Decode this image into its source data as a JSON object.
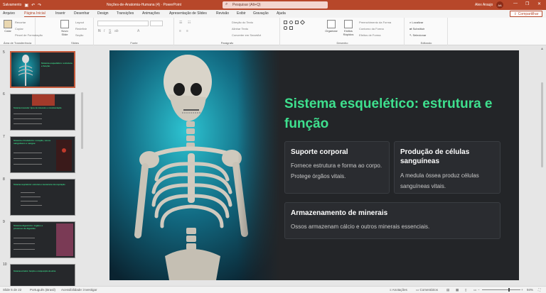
{
  "titlebar": {
    "autosave": "Salvamento",
    "doc_title": "Noções-de-Anatomia-Humana (4)  ·  PowerPoint",
    "search_placeholder": "Pesquisar (Alt+Q)",
    "user": "Alex Araujo",
    "avatar": "AA",
    "minimize": "—",
    "restore": "❐",
    "close": "✕"
  },
  "tabs": [
    "Arquivo",
    "Página Inicial",
    "Inserir",
    "Desenhar",
    "Design",
    "Transições",
    "Animações",
    "Apresentação de Slides",
    "Revisão",
    "Exibir",
    "Gravação",
    "Ajuda"
  ],
  "active_tab": "Página Inicial",
  "share_label": "Compartilhar",
  "ribbon": {
    "clipboard": {
      "label": "Área de Transferência",
      "paste": "Colar",
      "cut": "Recortar",
      "copy": "Copiar",
      "format_painter": "Pincel de Formatação"
    },
    "slides": {
      "label": "Slides",
      "new_slide": "Novo Slide",
      "layout": "Layout",
      "reset": "Redefinir",
      "section": "Seção"
    },
    "font": {
      "label": "Fonte"
    },
    "paragraph": {
      "label": "Parágrafo",
      "text_direction": "Direção do Texto",
      "align_text": "Alinhar Texto",
      "smartart": "Converter em SmartArt"
    },
    "drawing": {
      "label": "Desenho",
      "arrange": "Organizar",
      "quick_styles": "Estilos Rápidos",
      "fill": "Preenchimento da Forma",
      "outline": "Contorno da Forma",
      "effects": "Efeitos de Forma"
    },
    "editing": {
      "label": "Editando",
      "find": "Localizar",
      "replace": "Substituir",
      "select": "Selecionar"
    }
  },
  "thumbnails": [
    {
      "num": "5",
      "title": "Sistema esquelético: estrutura e função"
    },
    {
      "num": "6",
      "title": "Sistema muscular: tipos de músculos e movimentação"
    },
    {
      "num": "7",
      "title": "Sistema circulatório: coração, vasos sanguíneos e sangue"
    },
    {
      "num": "8",
      "title": "Sistema respiratório: estrutura e mecanismo da respiração"
    },
    {
      "num": "9",
      "title": "Sistema digestório: órgãos e processo de digestão"
    },
    {
      "num": "10",
      "title": "Sistema urinário: função e composição da urina"
    }
  ],
  "slide": {
    "title": "Sistema esquelético: estrutura e função",
    "cards": [
      {
        "heading": "Suporte corporal",
        "body": "Fornece estrutura e forma ao corpo. Protege órgãos vitais."
      },
      {
        "heading": "Produção de células sanguíneas",
        "body": "A medula óssea produz células sanguíneas vitais."
      },
      {
        "heading": "Armazenamento de minerais",
        "body": "Ossos armazenam cálcio e outros minerais essenciais."
      }
    ]
  },
  "statusbar": {
    "slide_count": "Slide 5 de 22",
    "language": "Português (Brasil)",
    "accessibility": "Acessibilidade: investigar",
    "notes": "Anotações",
    "comments": "Comentários",
    "zoom": "94%"
  }
}
